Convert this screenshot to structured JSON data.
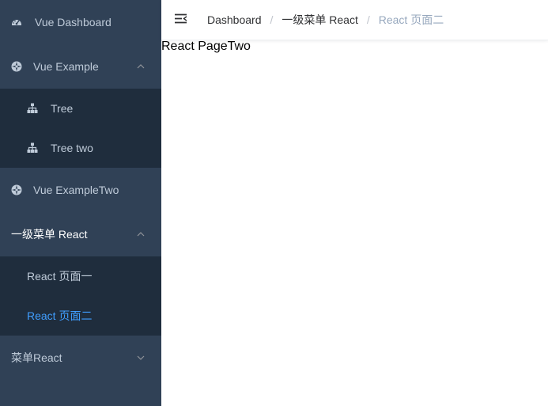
{
  "sidebar": {
    "items": [
      {
        "label": "Vue Dashboard",
        "icon": "dashboard-icon"
      },
      {
        "label": "Vue Example",
        "icon": "example-icon",
        "expanded": true,
        "children": [
          {
            "label": "Tree",
            "icon": "tree-icon"
          },
          {
            "label": "Tree two",
            "icon": "tree-icon"
          }
        ]
      },
      {
        "label": "Vue ExampleTwo",
        "icon": "example-icon"
      },
      {
        "label": "一级菜单 React",
        "expanded": true,
        "children": [
          {
            "label": "React 页面一"
          },
          {
            "label": "React 页面二",
            "active": true
          }
        ]
      },
      {
        "label": "菜单React",
        "expanded": false
      }
    ]
  },
  "topbar": {
    "breadcrumb": [
      "Dashboard",
      "一级菜单 React",
      "React 页面二"
    ],
    "separator": "/"
  },
  "main": {
    "text": "React PageTwo"
  },
  "colors": {
    "sidebar_bg": "#304156",
    "submenu_bg": "#1f2d3d",
    "active": "#409eff",
    "menu_text": "#bfcbd9"
  }
}
